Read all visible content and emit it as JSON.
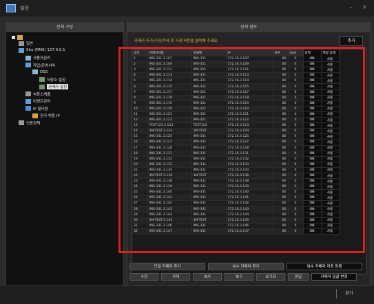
{
  "window": {
    "title": "설정"
  },
  "left_panel": {
    "header": "전체 구성",
    "tree": [
      {
        "label": "일반",
        "indent": 1,
        "icon": "gear-icon"
      },
      {
        "label": "Site (RMS) 127.0.0.1",
        "indent": 1,
        "icon": "server-icon"
      },
      {
        "label": "사용자관리",
        "indent": 2,
        "icon": "users-icon"
      },
      {
        "label": "작업/운영서버",
        "indent": 2,
        "icon": "server-icon"
      },
      {
        "label": "DSS",
        "indent": 3,
        "icon": "pc-icon"
      },
      {
        "label": "저장소 설정",
        "indent": 4,
        "icon": "storage-icon"
      },
      {
        "label": "카메라 설정",
        "indent": 4,
        "icon": "camera-icon"
      },
      {
        "label": "녹화스케줄",
        "indent": 2,
        "icon": "schedule-icon"
      },
      {
        "label": "이벤트관리",
        "indent": 2,
        "icon": "event-icon"
      },
      {
        "label": "IP 필터링",
        "indent": 2,
        "icon": "filter-icon"
      },
      {
        "label": "관리 허용 IP",
        "indent": 3,
        "icon": "ip-icon"
      },
      {
        "label": "인증정책",
        "indent": 1,
        "icon": "policy-icon"
      }
    ]
  },
  "right_panel": {
    "header": "상세 정보",
    "info_text": "카메라 추가/수정/삭제 후 저장 버튼을 클릭해 주세요.",
    "add_button": "추가"
  },
  "table": {
    "columns": [
      "순번",
      "카메라이름",
      "모델명",
      "IP",
      "포트",
      "Unit",
      "운영",
      "저장 상태"
    ],
    "rows": [
      [
        "1",
        "IMS-321.3.107",
        "IMS-321",
        "172.16.3.107",
        "80",
        "0",
        "ON",
        "사용"
      ],
      [
        "2",
        "IMS-321.3.109",
        "IMS-321",
        "172.16.3.109",
        "80",
        "0",
        "ON",
        "사용"
      ],
      [
        "3",
        "IMS-321.3.111",
        "IMS-321",
        "172.16.3.111",
        "80",
        "0",
        "ON",
        "사용"
      ],
      [
        "4",
        "IMS-321.3.113",
        "IMS-321",
        "172.16.3.113",
        "80",
        "0",
        "ON",
        "사용"
      ],
      [
        "5",
        "IMS-321.3.114",
        "IMS-321",
        "172.16.3.114",
        "80",
        "0",
        "ON",
        "사용"
      ],
      [
        "6",
        "IMS-321.3.115",
        "IMS-321",
        "172.16.3.115",
        "80",
        "0",
        "ON",
        "사용"
      ],
      [
        "7",
        "IMS-321.3.117",
        "IMS-321",
        "172.16.3.117",
        "80",
        "0",
        "ON",
        "사용"
      ],
      [
        "8",
        "IMS-321.3.118",
        "IMS-321",
        "172.16.3.118",
        "80",
        "0",
        "ON",
        "사용"
      ],
      [
        "9",
        "IMS-321.3.119",
        "IMS-321",
        "172.16.3.119",
        "80",
        "0",
        "ON",
        "사용"
      ],
      [
        "10",
        "IMS-321.3.120",
        "IMS-321",
        "172.16.3.120",
        "80",
        "0",
        "ON",
        "사용"
      ],
      [
        "11",
        "IMS-321.3.121",
        "IMS-321",
        "172.16.3.121",
        "80",
        "0",
        "ON",
        "사용"
      ],
      [
        "12",
        "IMS-321.3.122",
        "IMS-321",
        "172.16.3.122",
        "80",
        "0",
        "ON",
        "사용"
      ],
      [
        "13",
        "TEST123.3.123",
        "TEST123",
        "172.16.3.123",
        "80",
        "0",
        "ON",
        "사용"
      ],
      [
        "14",
        "3M-TEST.3.124",
        "3M-TEST",
        "172.16.3.124",
        "80",
        "0",
        "ON",
        "사용"
      ],
      [
        "15",
        "IMS-331.3.125",
        "IMS-331",
        "172.16.3.125",
        "80",
        "0",
        "ON",
        "사용"
      ],
      [
        "16",
        "IMS-331.3.127",
        "IMS-331",
        "172.16.3.127",
        "80",
        "0",
        "ON",
        "사용"
      ],
      [
        "17",
        "IMS-331.3.128",
        "IMS-331",
        "172.16.3.128",
        "80",
        "0",
        "ON",
        "사용"
      ],
      [
        "18",
        "IMS-331.3.131",
        "IMS-331",
        "172.16.3.131",
        "80",
        "0",
        "ON",
        "사용"
      ],
      [
        "19",
        "IMS-331.3.132",
        "IMS-331",
        "172.16.3.132",
        "80",
        "0",
        "ON",
        "사용"
      ],
      [
        "20",
        "IMS-331.3.133",
        "IMS-331",
        "172.16.3.133",
        "80",
        "0",
        "ON",
        "사용"
      ],
      [
        "21",
        "IMS-331.3.134",
        "IMS-331",
        "172.16.3.134",
        "80",
        "0",
        "ON",
        "사용"
      ],
      [
        "22",
        "3M-TEST.3.136",
        "3M-TEST",
        "172.16.3.136",
        "80",
        "0",
        "ON",
        "사용"
      ],
      [
        "23",
        "IMS-331.3.138",
        "IMS-331",
        "172.16.3.138",
        "80",
        "0",
        "ON",
        "사용"
      ],
      [
        "24",
        "IMS-331.3.139",
        "IMS-331",
        "172.16.3.139",
        "80",
        "0",
        "ON",
        "사용"
      ],
      [
        "25",
        "IMS-331.3.140",
        "IMS-331",
        "172.16.3.140",
        "80",
        "0",
        "ON",
        "사용"
      ],
      [
        "26",
        "IMS-331.3.141",
        "IMS-331",
        "172.16.3.141",
        "80",
        "0",
        "ON",
        "사용"
      ],
      [
        "27",
        "IMS-331.3.142",
        "IMS-331",
        "172.16.3.142",
        "80",
        "0",
        "ON",
        "사용"
      ],
      [
        "28",
        "IMS-331.3.143",
        "IMS-331",
        "172.16.3.143",
        "80",
        "0",
        "ON",
        "사용"
      ],
      [
        "29",
        "IMS-331.3.144",
        "IMS-331",
        "172.16.3.144",
        "80",
        "0",
        "ON",
        "사용"
      ],
      [
        "30",
        "3M-TEST.3.145",
        "3M-TEST",
        "172.16.3.145",
        "80",
        "0",
        "ON",
        "사용"
      ],
      [
        "31",
        "IMS-331.3.146",
        "IMS-331",
        "172.16.3.146",
        "80",
        "0",
        "ON",
        "사용"
      ],
      [
        "32",
        "IMS-331.3.147",
        "IMS-331",
        "172.16.3.147",
        "80",
        "0",
        "ON",
        "사용"
      ]
    ]
  },
  "buttons": {
    "row1": [
      "단일 카메라 추가",
      "복수 카메라 추가",
      "복수 카메라 자동 등록"
    ],
    "row2": [
      "수정",
      "삭제",
      "복사",
      "복구",
      "초기화",
      "동일",
      "카메라 일괄 변경"
    ]
  },
  "footer": {
    "close": "닫기"
  }
}
